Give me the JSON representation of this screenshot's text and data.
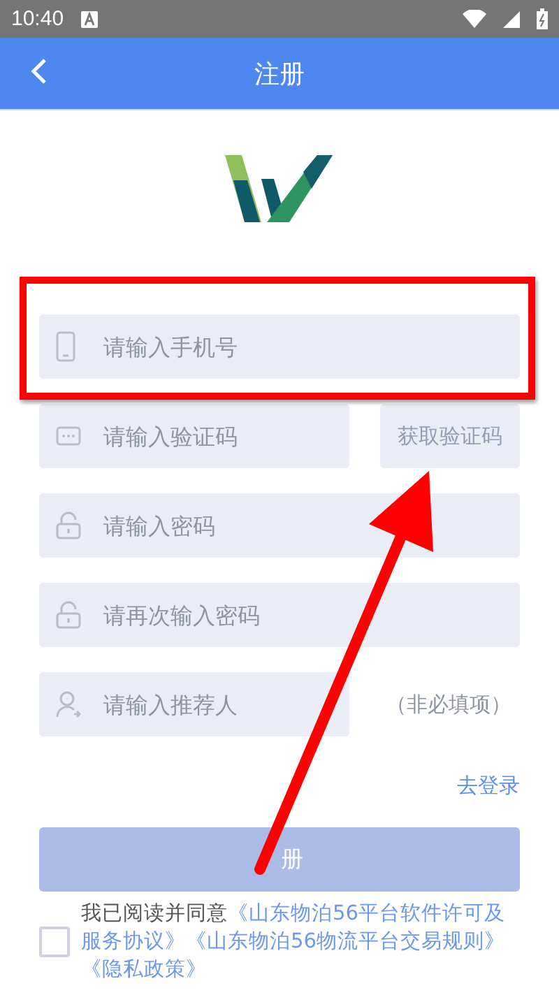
{
  "status_bar": {
    "time": "10:40"
  },
  "header": {
    "title": "注册"
  },
  "fields": [
    {
      "kind": "phone",
      "placeholder": "请输入手机号"
    },
    {
      "kind": "code",
      "placeholder": "请输入验证码",
      "button": {
        "label": "获取验证码",
        "disabled": true
      }
    },
    {
      "kind": "lock",
      "placeholder": "请输入密码"
    },
    {
      "kind": "lock",
      "placeholder": "请再次输入密码"
    },
    {
      "kind": "user",
      "placeholder": "请输入推荐人",
      "note": "（非必填项）"
    }
  ],
  "login_link": "去登录",
  "register_button": {
    "label": "册",
    "disabled": true
  },
  "agreement": {
    "checked": false,
    "prefix": "我已阅读并同意",
    "links": [
      "《山东物泊56平台软件许可及服务协议》",
      "《山东物泊56物流平台交易规则》",
      "《隐私政策》"
    ]
  }
}
